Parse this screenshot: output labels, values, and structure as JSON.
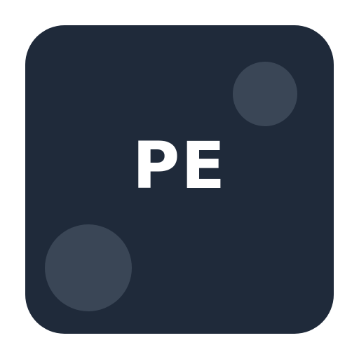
{
  "app_icon": {
    "monogram": "PE",
    "colors": {
      "page_background": "#ffffff",
      "tile_background": "#1f2a3a",
      "decorative_circles": "#3a4656",
      "monogram_text": "#ffffff"
    }
  }
}
